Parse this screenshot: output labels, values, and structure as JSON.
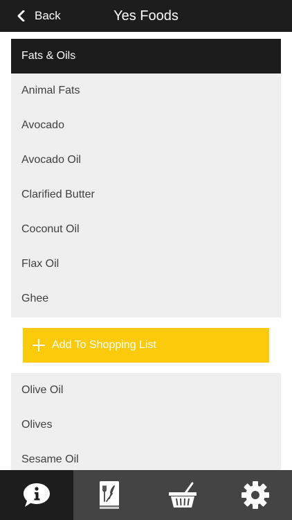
{
  "header": {
    "back_label": "Back",
    "title": "Yes Foods",
    "back_icon": "chevron-left-icon"
  },
  "list": {
    "section_title": "Fats & Oils",
    "items_before": [
      "Animal Fats",
      "Avocado",
      "Avocado Oil",
      "Clarified Butter",
      "Coconut Oil",
      "Flax Oil",
      "Ghee"
    ],
    "action": {
      "label": "Add To Shopping List",
      "icon": "plus-icon",
      "color": "#fbca0a"
    },
    "items_after": [
      "Olive Oil",
      "Olives",
      "Sesame Oil"
    ]
  },
  "tabbar": {
    "tabs": [
      {
        "icon": "info-speech-bubble-icon",
        "active": true
      },
      {
        "icon": "recipe-book-icon",
        "active": false
      },
      {
        "icon": "shopping-basket-icon",
        "active": false
      },
      {
        "icon": "gear-icon",
        "active": false
      }
    ]
  },
  "colors": {
    "header_bg": "#1d1d1d",
    "list_bg": "#efefef",
    "tabbar_bg": "#444444",
    "accent": "#fbca0a"
  }
}
